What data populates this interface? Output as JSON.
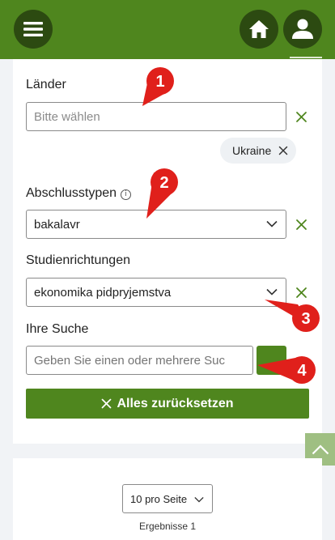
{
  "header": {
    "menu_icon": "hamburger-menu-icon",
    "home_icon": "home-icon",
    "user_icon": "user-icon"
  },
  "filters": {
    "countries": {
      "label": "Länder",
      "placeholder": "Bitte wählen",
      "selected_chip": "Ukraine"
    },
    "degree_types": {
      "label": "Abschlusstypen",
      "info_glyph": "i",
      "value": "bakalavr"
    },
    "fields_of_study": {
      "label": "Studienrichtungen",
      "value": "ekonomika pidpryjemstva"
    },
    "search": {
      "label": "Ihre Suche",
      "placeholder": "Geben Sie einen oder mehrere Suc"
    },
    "reset_label": "Alles zurücksetzen"
  },
  "results": {
    "per_page": "10 pro Seite",
    "count_text": "Ergebnisse 1"
  },
  "annotations": [
    "1",
    "2",
    "3",
    "4"
  ],
  "colors": {
    "brand_green": "#4f861e",
    "dark_green": "#2c4a11",
    "annotation_red": "#e0201b"
  }
}
